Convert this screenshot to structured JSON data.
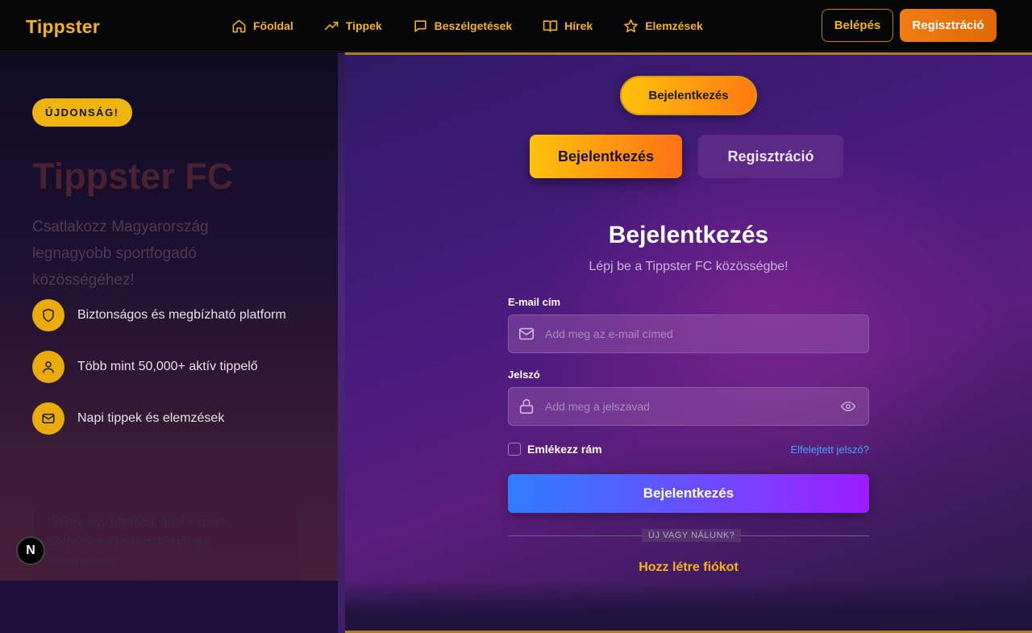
{
  "brand": "Tippster",
  "nav": {
    "items": [
      {
        "label": "Főoldal",
        "icon": "home-icon"
      },
      {
        "label": "Tippek",
        "icon": "trending-up-icon"
      },
      {
        "label": "Beszélgetések",
        "icon": "chat-icon"
      },
      {
        "label": "Hírek",
        "icon": "book-icon"
      },
      {
        "label": "Elemzések",
        "icon": "star-icon"
      }
    ],
    "login_label": "Belépés",
    "register_label": "Regisztráció"
  },
  "hero": {
    "badge": "ÚJDONSÁG!",
    "title": "Tippster FC",
    "subtitle": "Csatlakozz Magyarország legnagyobb sportfogadó közösségéhez!",
    "features": [
      {
        "text": "Biztonságos és megbízható platform",
        "icon": "shield-icon"
      },
      {
        "text": "Több mint 50,000+ aktív tippelő",
        "icon": "user-icon"
      },
      {
        "text": "Napi tippek és elemzések",
        "icon": "mail-icon"
      }
    ],
    "quote": "\"Végre egy platform, ahol a sport szerelmesei találkozhatnak és tippelhetnek!\"",
    "quote_author": "- Péter, aktív tippelő"
  },
  "devtools_badge": "N",
  "auth": {
    "pill_label": "Bejelentkezés",
    "tab_login": "Bejelentkezés",
    "tab_register": "Regisztráció",
    "title": "Bejelentkezés",
    "subtitle": "Lépj be a Tippster FC közösségbe!",
    "email_label": "E-mail cím",
    "email_placeholder": "Add meg az e-mail címed",
    "email_value": "",
    "password_label": "Jelszó",
    "password_placeholder": "Add meg a jelszavad",
    "password_value": "",
    "remember_label": "Emlékezz rám",
    "remember_checked": false,
    "forgot_label": "Elfelejtett jelszó?",
    "submit_label": "Bejelentkezés",
    "separator": "ÚJ VAGY NÁLUNK?",
    "create_label": "Hozz létre fiókot"
  },
  "colors": {
    "accent": "#f5b31a",
    "orange": "#f07d10",
    "link": "#4aa3ff"
  }
}
